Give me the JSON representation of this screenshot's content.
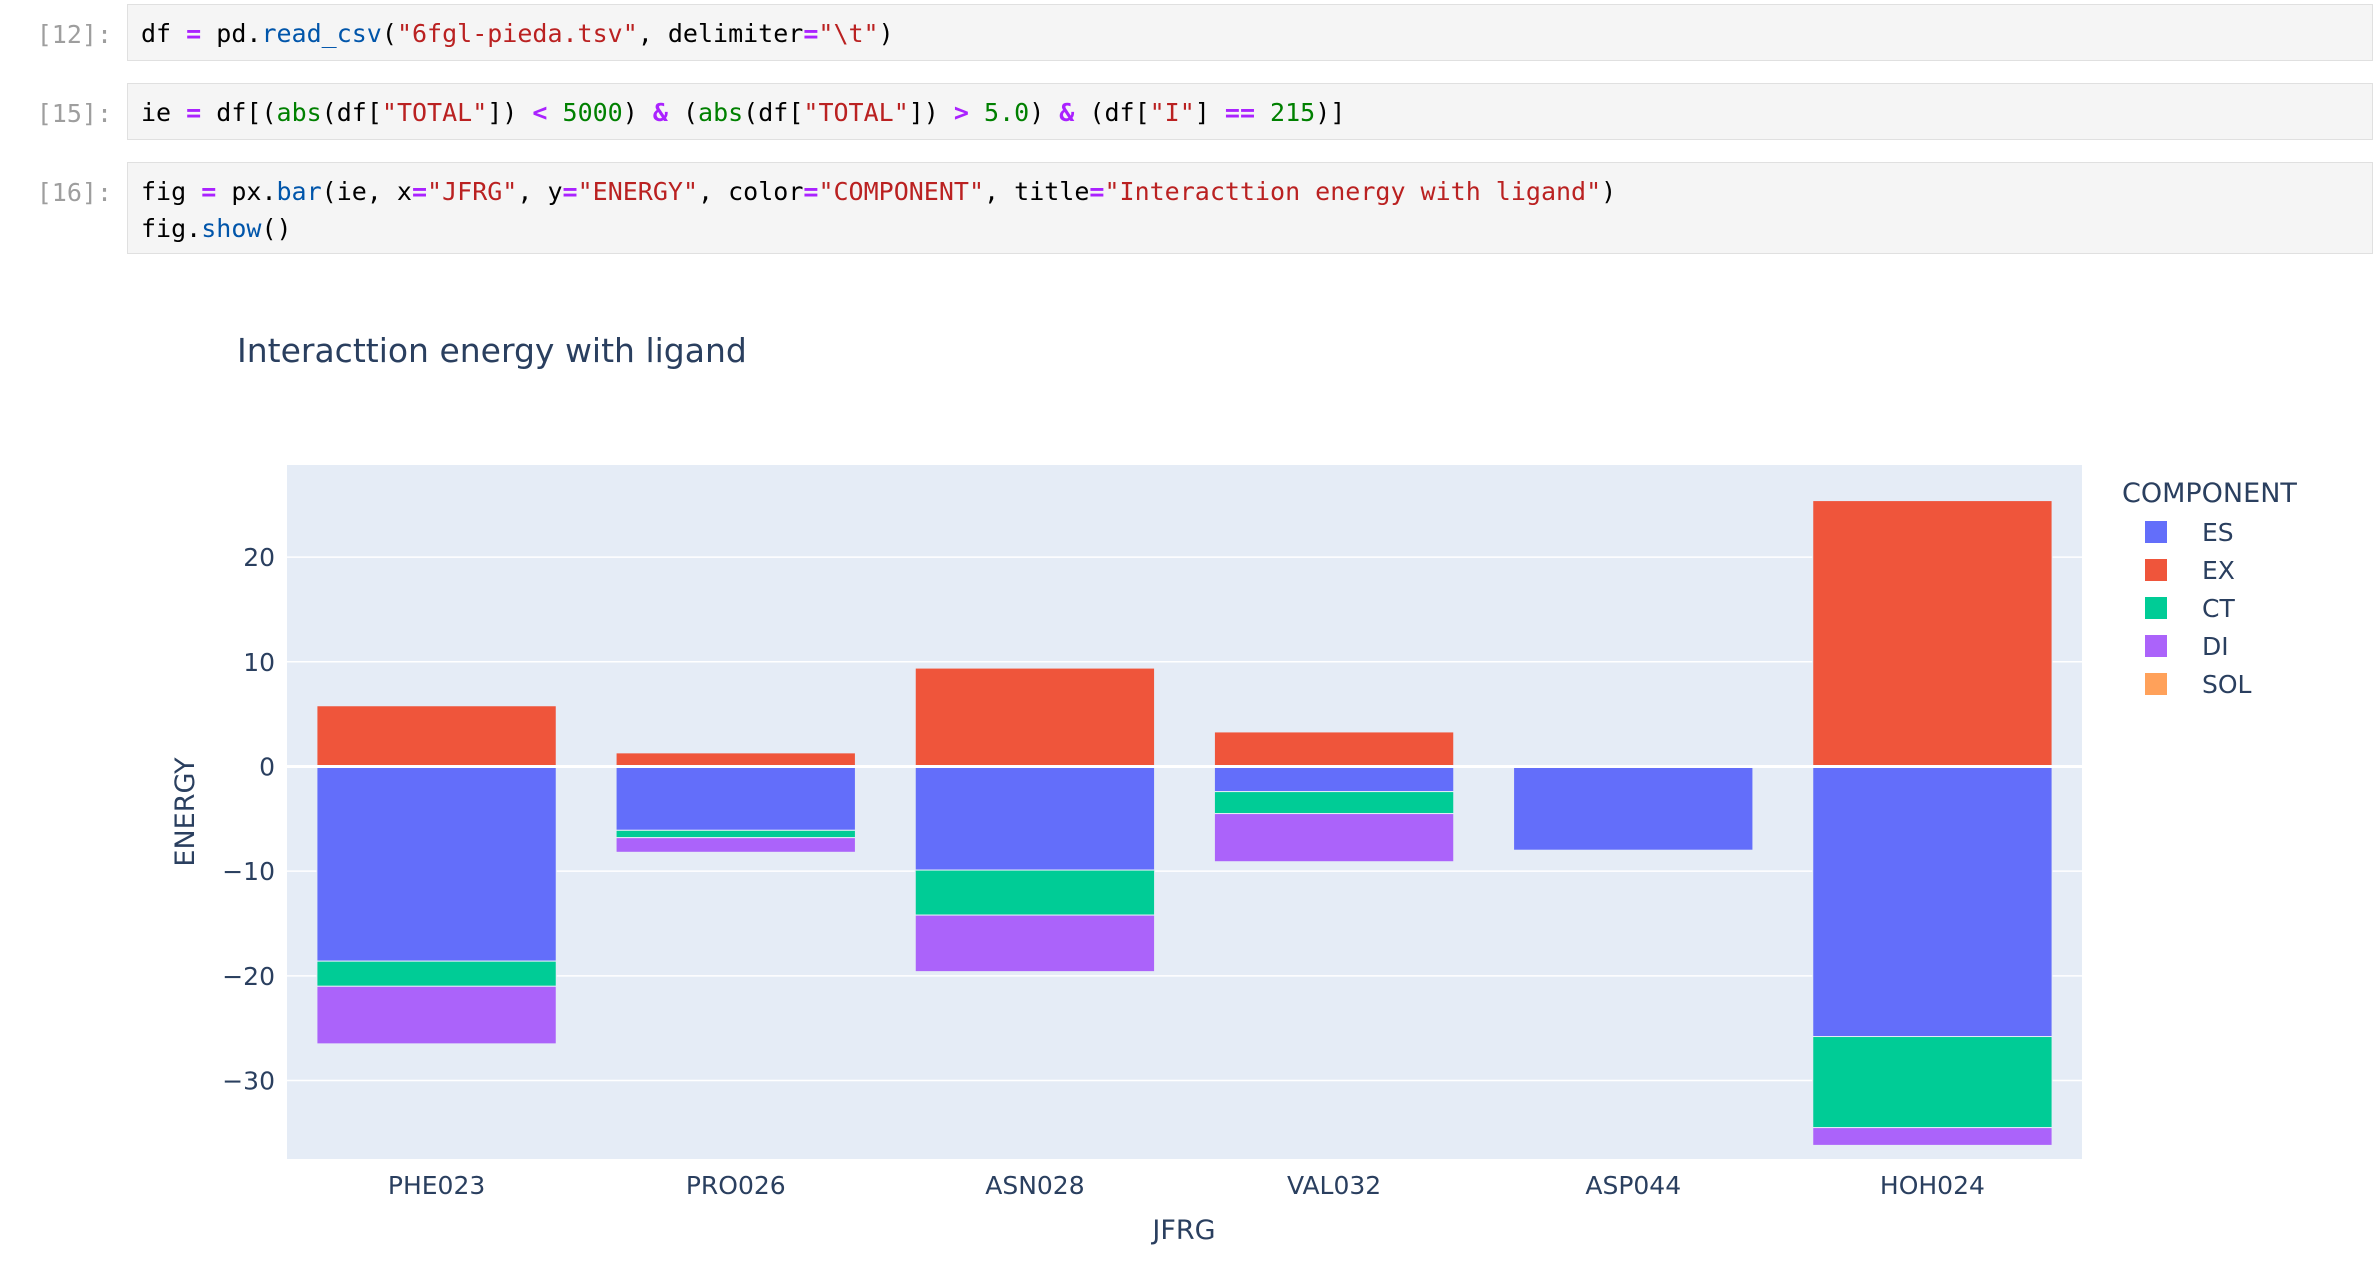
{
  "cells": [
    {
      "prompt": "[12]:"
    },
    {
      "prompt": "[15]:"
    },
    {
      "prompt": "[16]:"
    }
  ],
  "code": {
    "c12": {
      "var": "df",
      "eq": "=",
      "mod": "pd.",
      "fn": "read_csv",
      "p1": "(",
      "file": "\"6fgl-pieda.tsv\"",
      "comma": ", ",
      "kw": "delimiter",
      "eq2": "=",
      "delim": "\"\\t\"",
      "p2": ")"
    },
    "c15": {
      "var": "ie",
      "eq": "=",
      "a1": "df[(",
      "abs1": "abs",
      "a2": "(df[",
      "s1": "\"TOTAL\"",
      "a3": "]) ",
      "lt": "<",
      "n1": " 5000",
      "a4": ") ",
      "and1": "&",
      "a5": " (",
      "abs2": "abs",
      "a6": "(df[",
      "s2": "\"TOTAL\"",
      "a7": "]) ",
      "gt": ">",
      "n2": " 5.0",
      "a8": ") ",
      "and2": "&",
      "a9": " (df[",
      "s3": "\"I\"",
      "a10": "] ",
      "eqeq": "==",
      "n3": " 215",
      "a11": ")]"
    },
    "c16": {
      "l1_var": "fig",
      "l1_eq": "=",
      "l1_mod": "px.",
      "l1_fn": "bar",
      "l1_a": "(ie, ",
      "kx": "x",
      "e1": "=",
      "sx": "\"JFRG\"",
      "c1": ", ",
      "ky": "y",
      "e2": "=",
      "sy": "\"ENERGY\"",
      "c2": ", ",
      "kc": "color",
      "e3": "=",
      "sc": "\"COMPONENT\"",
      "c3": ", ",
      "kt": "title",
      "e4": "=",
      "stt": "\"Interacttion energy with ligand\"",
      "l1_end": ")",
      "l2_var": "fig.",
      "l2_fn": "show",
      "l2_end": "()"
    }
  },
  "chart_data": {
    "type": "bar",
    "barmode": "relative",
    "title": "Interacttion energy with ligand",
    "xlabel": "JFRG",
    "ylabel": "ENERGY",
    "categories": [
      "PHE023",
      "PRO026",
      "ASN028",
      "VAL032",
      "ASP044",
      "HOH024"
    ],
    "ylim": [
      -37.5,
      28.8
    ],
    "yticks": [
      20,
      10,
      0,
      -10,
      -20,
      -30
    ],
    "ytick_labels": [
      "20",
      "10",
      "0",
      "−10",
      "−20",
      "−30"
    ],
    "legend_title": "COMPONENT",
    "legend_position": "top-right",
    "grid": true,
    "series": [
      {
        "name": "ES",
        "color": "#636efa",
        "values": [
          -18.6,
          -6.1,
          -9.9,
          -2.4,
          -8.0,
          -25.8
        ]
      },
      {
        "name": "EX",
        "color": "#ef553b",
        "values": [
          5.8,
          1.3,
          9.4,
          3.3,
          0.0,
          25.4
        ]
      },
      {
        "name": "CT",
        "color": "#00cc96",
        "values": [
          -2.4,
          -0.7,
          -4.3,
          -2.1,
          0.0,
          -8.7
        ]
      },
      {
        "name": "DI",
        "color": "#ab63fa",
        "values": [
          -5.5,
          -1.4,
          -5.4,
          -4.6,
          0.0,
          -1.7
        ]
      },
      {
        "name": "SOL",
        "color": "#ffa15a",
        "values": [
          0,
          0,
          0,
          0,
          0,
          0
        ]
      }
    ]
  }
}
